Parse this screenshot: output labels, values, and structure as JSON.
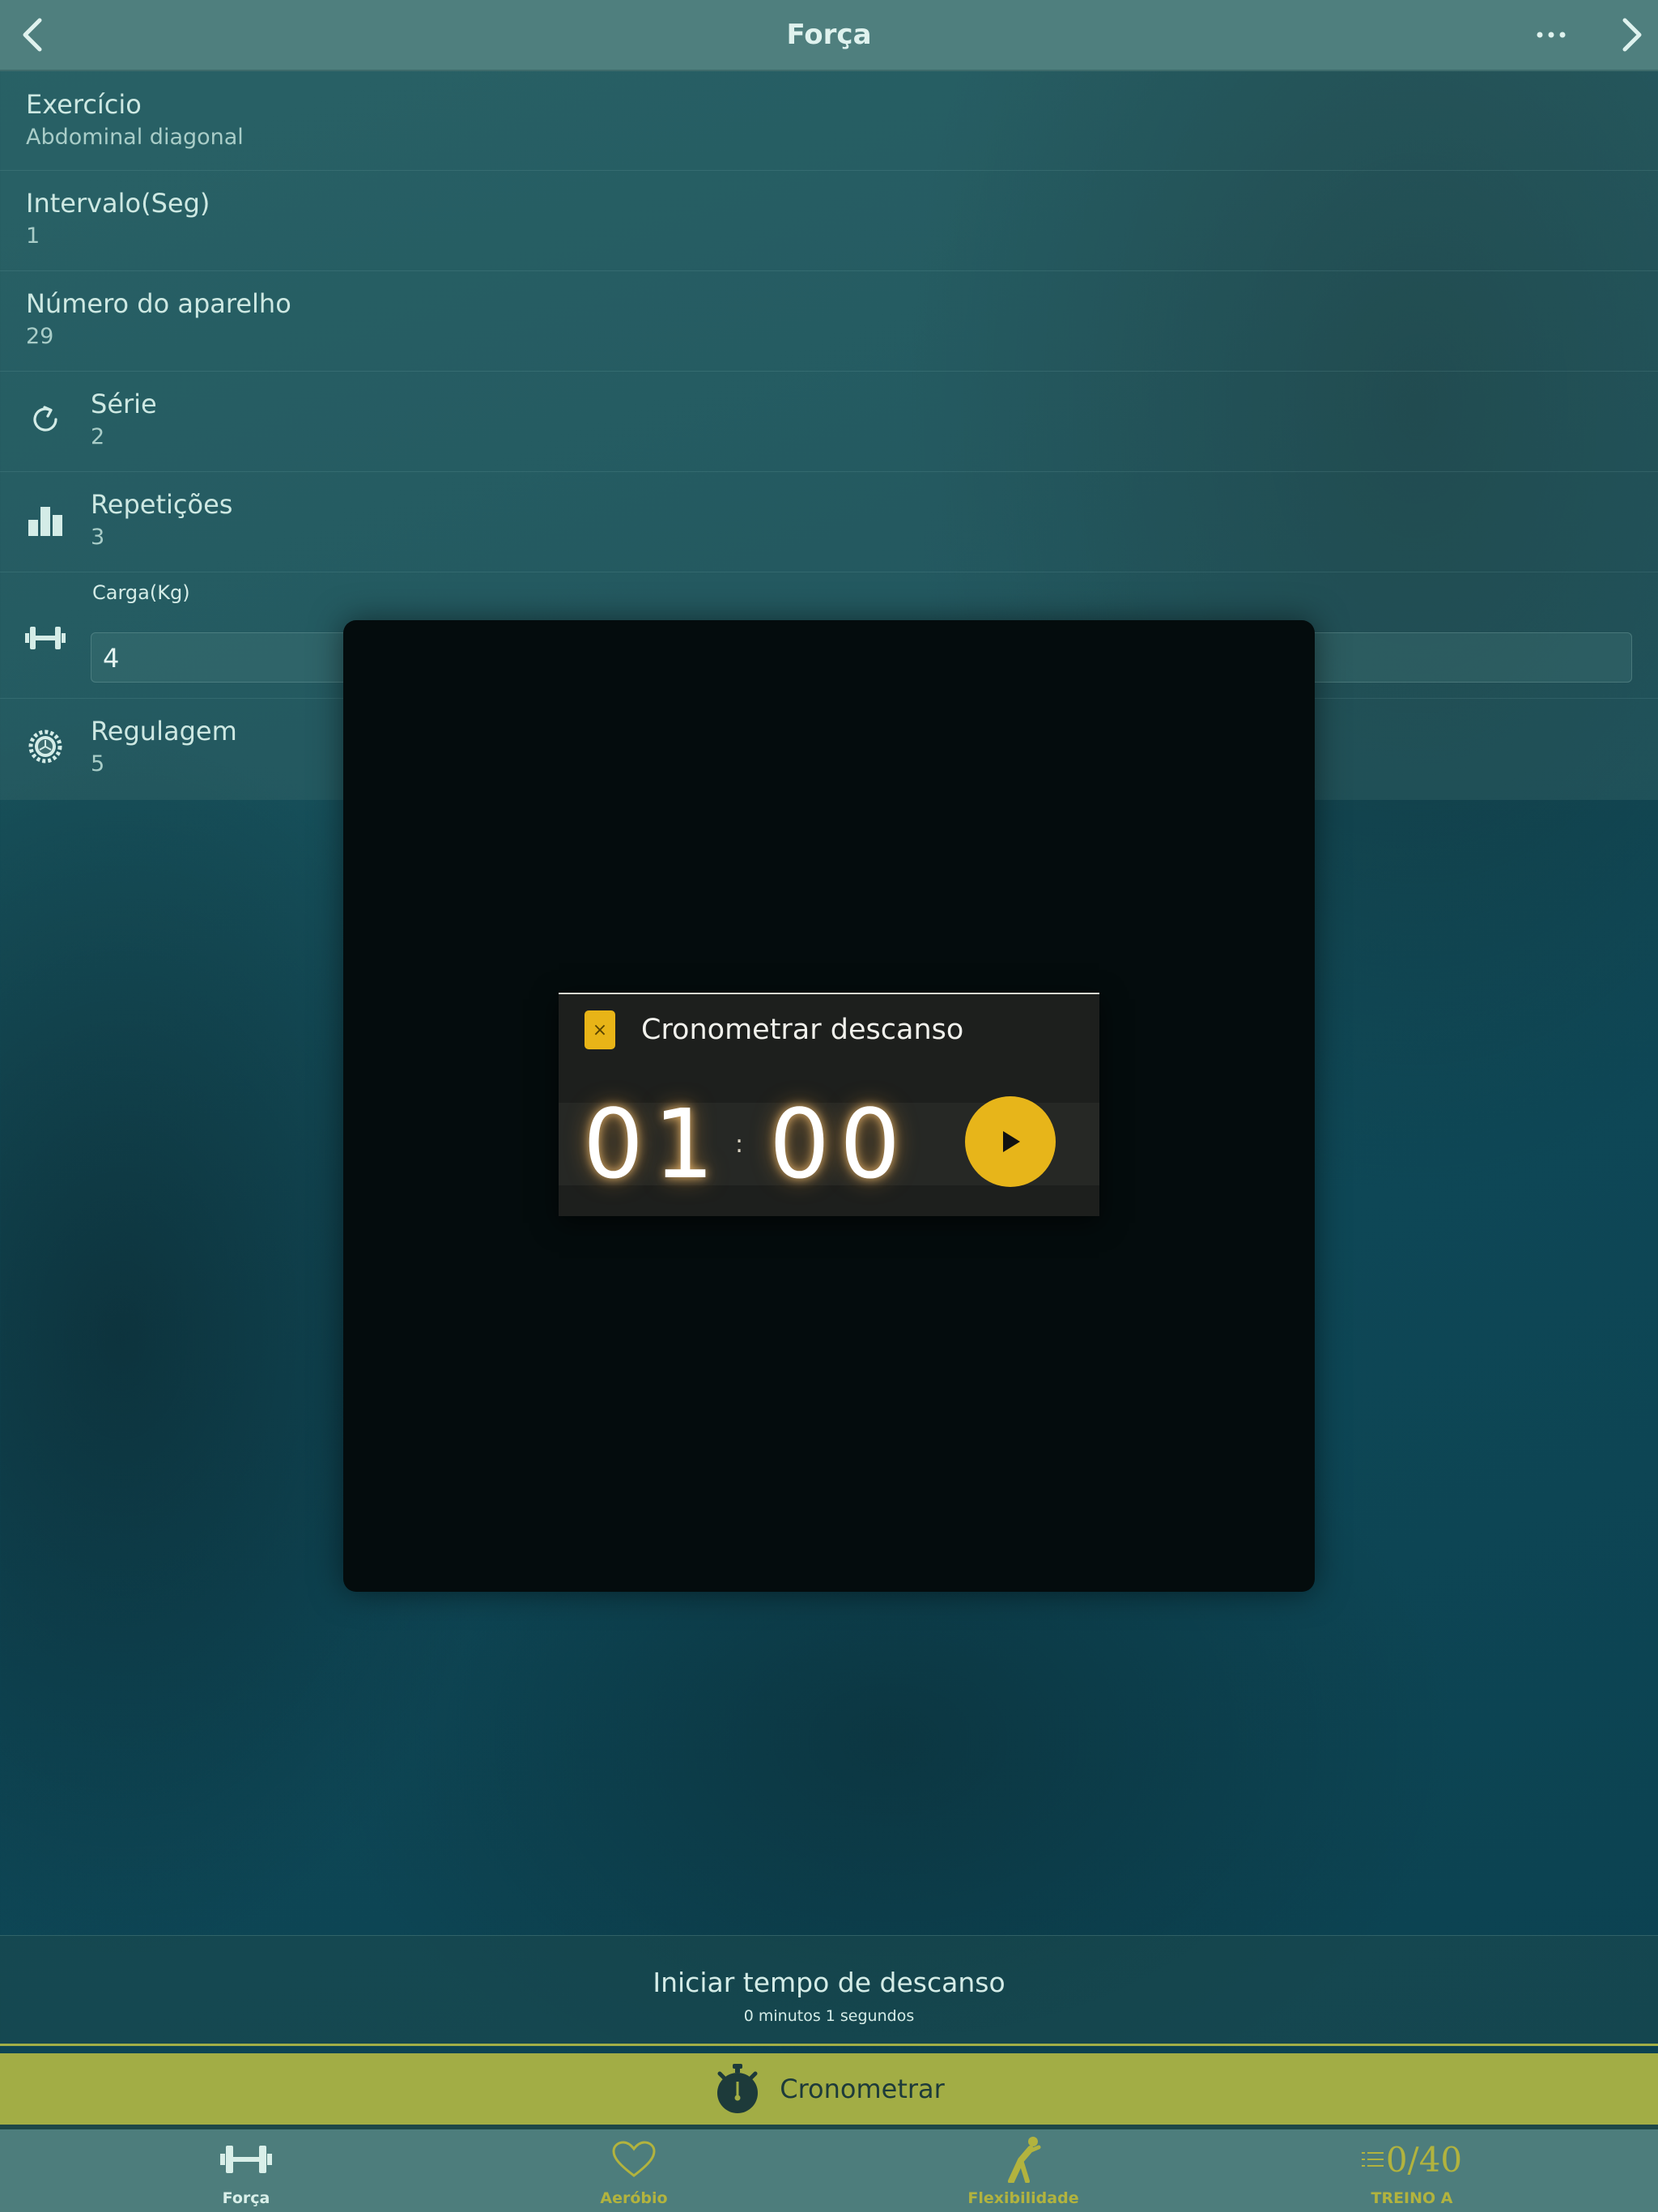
{
  "header": {
    "title": "Força"
  },
  "fields": {
    "exercise": {
      "label": "Exercício",
      "value": "Abdominal diagonal"
    },
    "interval": {
      "label": "Intervalo(Seg)",
      "value": "1"
    },
    "device": {
      "label": "Número do aparelho",
      "value": "29"
    },
    "series": {
      "label": "Série",
      "value": "2"
    },
    "reps": {
      "label": "Repetições",
      "value": "3"
    },
    "load": {
      "label": "Carga(Kg)",
      "value": "4"
    },
    "adjust": {
      "label": "Regulagem",
      "value": "5"
    }
  },
  "dialog": {
    "title": "Cronometrar descanso",
    "close_glyph": "×",
    "minutes": "01",
    "separator": ":",
    "seconds": "00"
  },
  "rest": {
    "title": "Iniciar tempo de descanso",
    "subtitle": "0 minutos 1 segundos"
  },
  "timer_button": {
    "label": "Cronometrar"
  },
  "tabs": [
    {
      "label": "Força",
      "icon": "dumbbell-icon",
      "active": true
    },
    {
      "label": "Aeróbio",
      "icon": "heart-icon",
      "active": false
    },
    {
      "label": "Flexibilidade",
      "icon": "stretching-icon",
      "active": false
    },
    {
      "label": "TREINO A",
      "icon": "list-icon",
      "counter": "0/40",
      "active": false
    }
  ],
  "colors": {
    "accent": "#e7b51a",
    "timer_bar": "#a2ad45",
    "tab_active": "#d9efe9",
    "tab_inactive": "#b2b33e"
  }
}
